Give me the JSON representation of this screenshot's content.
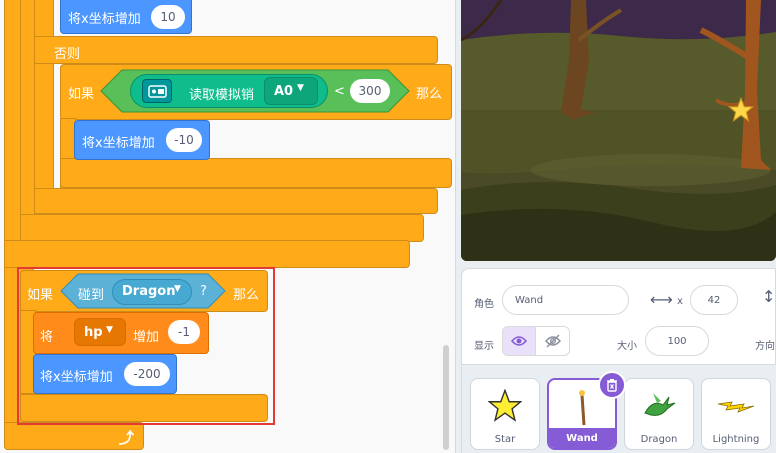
{
  "code": {
    "top_block": {
      "text": "将x坐标增加",
      "value": "10"
    },
    "else_label": "否则",
    "if1": {
      "if_label": "如果",
      "sensor_label": "读取模拟销",
      "pin": "A0",
      "operator": "<",
      "threshold": "300",
      "then_label": "那么"
    },
    "inner_block": {
      "text": "将x坐标增加",
      "value": "-10"
    },
    "if2": {
      "if_label": "如果",
      "touching_label": "碰到",
      "target": "Dragon",
      "question": "?",
      "then_label": "那么"
    },
    "var_block": {
      "set_label": "将",
      "var_name": "hp",
      "change_label": "增加",
      "value": "-1"
    },
    "move_block": {
      "text": "将x坐标增加",
      "value": "-200"
    }
  },
  "sprite_info": {
    "sprite_label": "角色",
    "sprite_name": "Wand",
    "x_label": "x",
    "x_value": "42",
    "show_label": "显示",
    "size_label": "大小",
    "size_value": "100",
    "direction_label": "方向"
  },
  "sprites": [
    {
      "name": "Star",
      "icon": "star-icon"
    },
    {
      "name": "Wand",
      "icon": "wand-icon",
      "selected": true
    },
    {
      "name": "Dragon",
      "icon": "dragon-icon"
    },
    {
      "name": "Lightning",
      "icon": "lightning-icon"
    }
  ],
  "colors": {
    "control": "#ffab19",
    "variables": "#ff8c1a",
    "motion": "#4c97ff",
    "operators": "#59c059",
    "sensing": "#5cb1d6",
    "selected": "#855cd6",
    "highlight": "#e53935"
  }
}
